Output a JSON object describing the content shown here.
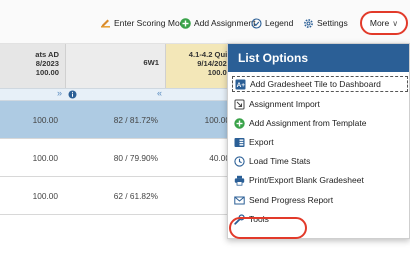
{
  "toolbar": {
    "scoring": "Enter Scoring Mode",
    "add_assignment": "Add Assignment",
    "legend": "Legend",
    "settings": "Settings",
    "more": "More"
  },
  "columns": [
    {
      "header": [
        "ats AD",
        "8/2023",
        "100.00"
      ],
      "values": [
        "100.00",
        "100.00",
        "100.00"
      ]
    },
    {
      "header": [
        "6W1"
      ],
      "values": [
        "82 / 81.72%",
        "80 / 79.90%",
        "62 / 61.82%"
      ]
    },
    {
      "header": [
        "4.1-4.2 Quiz",
        "9/14/2023",
        "100.00"
      ],
      "values": [
        "100.00",
        "40.00",
        "-"
      ]
    }
  ],
  "menu": {
    "title": "List Options",
    "items": [
      "Add Gradesheet Tile to Dashboard",
      "Assignment Import",
      "Add Assignment from Template",
      "Export",
      "Load Time Stats",
      "Print/Export Blank Gradesheet",
      "Send Progress Report",
      "Tools"
    ]
  },
  "colors": {
    "accent": "#2b5f96",
    "highlight": "#e23a2a",
    "selected_row": "#aecbe3",
    "gold_header": "#f3e7b8",
    "add_green": "#3aa34a"
  }
}
